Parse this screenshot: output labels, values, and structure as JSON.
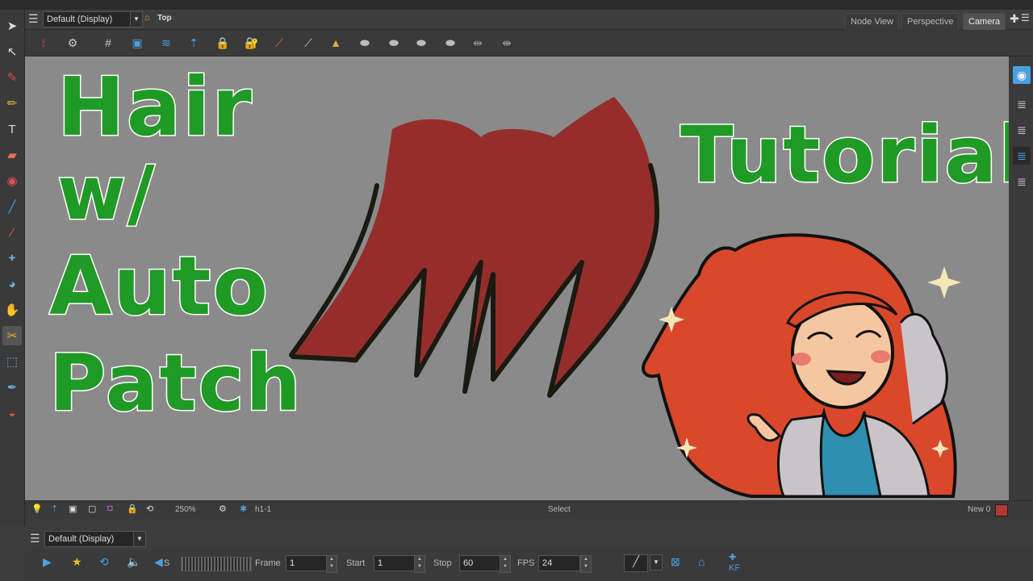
{
  "view": {
    "mode_dropdown": "Default (Display)",
    "breadcrumb": "Top",
    "tabs": [
      "Node View",
      "Perspective",
      "Camera"
    ],
    "active_tab": "Camera"
  },
  "status": {
    "zoom": "250%",
    "drawing_name": "h1-1",
    "tool_name": "Select",
    "new_color_label": "New 0",
    "new_color": "#b33a32"
  },
  "timeline": {
    "mode_dropdown": "Default (Display)",
    "frame_label": "Frame",
    "frame_value": "1",
    "start_label": "Start",
    "start_value": "1",
    "stop_label": "Stop",
    "stop_value": "60",
    "fps_label": "FPS",
    "fps_value": "24",
    "sound_label": "S",
    "kf_label": "KF"
  },
  "overlay": {
    "title_line1": "Hair",
    "title_line2": "w/",
    "title_line3": "Auto",
    "title_line4": "Patch",
    "title_right": "Tutorial"
  },
  "colors": {
    "accent_green": "#1f9a24",
    "hair_fill": "#952e2b",
    "canvas_bg": "#8a8a8a",
    "ui_bg": "#3a3a3a"
  }
}
